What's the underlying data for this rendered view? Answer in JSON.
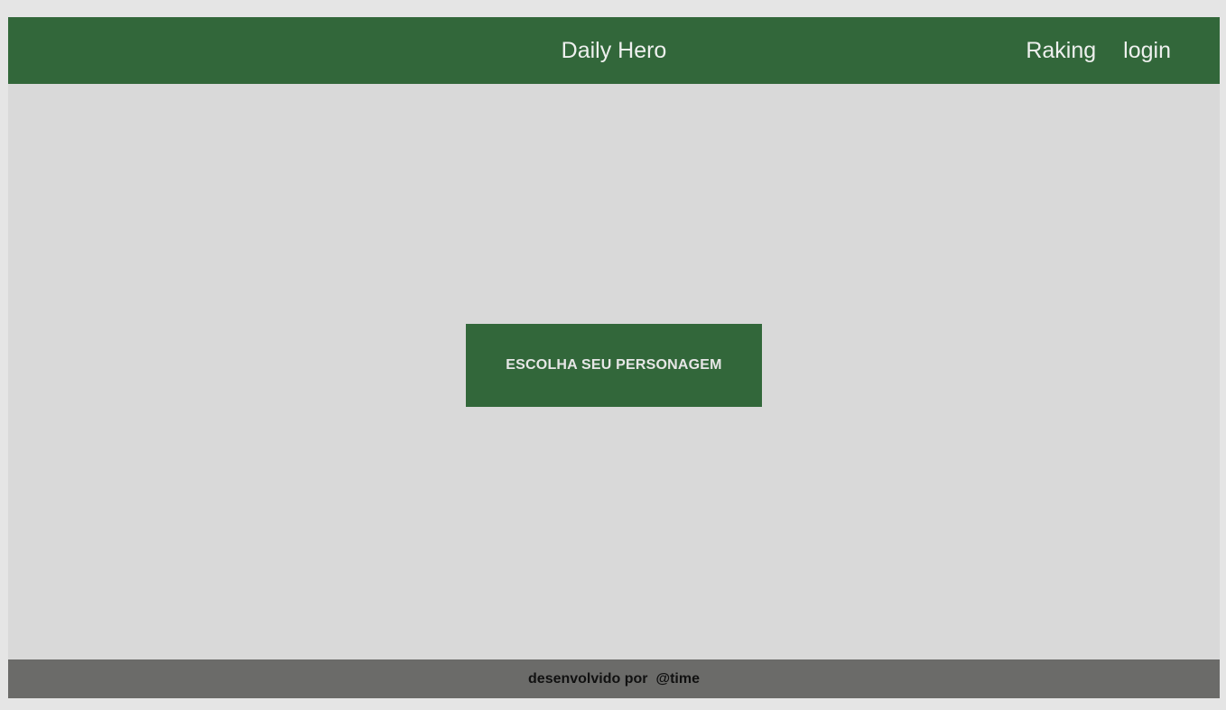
{
  "header": {
    "title": "Daily Hero",
    "nav": [
      {
        "label": "Raking"
      },
      {
        "label": "login"
      }
    ]
  },
  "main": {
    "cta_label": "ESCOLHA SEU PERSONAGEM"
  },
  "footer": {
    "text": "desenvolvido por",
    "credit": "@time"
  },
  "colors": {
    "primary_green": "#32673a",
    "content_background": "#d9d9d9",
    "footer_background": "#6b6b69",
    "page_background": "#e5e5e5"
  }
}
